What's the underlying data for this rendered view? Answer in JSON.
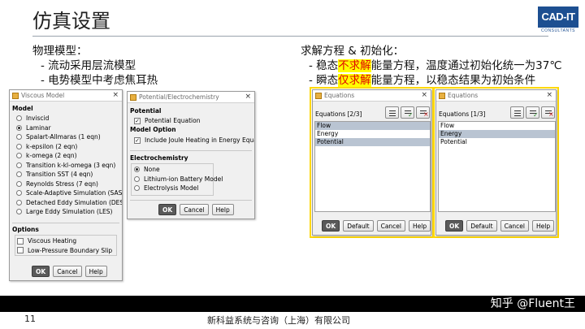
{
  "slide": {
    "title": "仿真设置",
    "page_number": "11",
    "company": "新科益系统与咨询（上海）有限公司",
    "footer_brand": "知乎 @Fluent王"
  },
  "logo": {
    "main": "CAD-IT",
    "sub": "CONSULTANTS"
  },
  "left_text": {
    "heading": "物理模型：",
    "bullets": [
      "- 流动采用层流模型",
      "- 电势模型中考虑焦耳热"
    ]
  },
  "right_text": {
    "heading": "求解方程 & 初始化：",
    "bullet1": {
      "prefix": "- 稳态",
      "highlight": "不求解",
      "suffix": "能量方程，温度通过初始化统一为37℃"
    },
    "bullet2": {
      "prefix": "- 瞬态",
      "highlight": "仅求解",
      "suffix": "能量方程，以稳态结果为初始条件"
    }
  },
  "viscous_dialog": {
    "title": "Viscous Model",
    "model_label": "Model",
    "models": [
      {
        "label": "Inviscid",
        "selected": false
      },
      {
        "label": "Laminar",
        "selected": true
      },
      {
        "label": "Spalart-Allmaras (1 eqn)",
        "selected": false
      },
      {
        "label": "k-epsilon (2 eqn)",
        "selected": false
      },
      {
        "label": "k-omega (2 eqn)",
        "selected": false
      },
      {
        "label": "Transition k-kl-omega (3 eqn)",
        "selected": false
      },
      {
        "label": "Transition SST (4 eqn)",
        "selected": false
      },
      {
        "label": "Reynolds Stress (7 eqn)",
        "selected": false
      },
      {
        "label": "Scale-Adaptive Simulation (SAS)",
        "selected": false
      },
      {
        "label": "Detached Eddy Simulation (DES)",
        "selected": false
      },
      {
        "label": "Large Eddy Simulation (LES)",
        "selected": false
      }
    ],
    "options_label": "Options",
    "options": [
      {
        "label": "Viscous Heating",
        "checked": false
      },
      {
        "label": "Low-Pressure Boundary Slip",
        "checked": false
      }
    ],
    "buttons": {
      "ok": "OK",
      "cancel": "Cancel",
      "help": "Help"
    }
  },
  "potential_dialog": {
    "title": "Potential/Electrochemistry",
    "potential_label": "Potential",
    "potential_equation": "Potential Equation",
    "model_option_label": "Model Option",
    "joule_heating": "Include Joule Heating in Energy Equation",
    "electrochem_label": "Electrochemistry",
    "electrochem_options": [
      {
        "label": "None",
        "selected": true
      },
      {
        "label": "Lithium-ion Battery Model",
        "selected": false
      },
      {
        "label": "Electrolysis Model",
        "selected": false
      }
    ],
    "buttons": {
      "ok": "OK",
      "cancel": "Cancel",
      "help": "Help"
    }
  },
  "equations_steady": {
    "title": "Equations",
    "count_label": "Equations  [2/3]",
    "items": [
      {
        "label": "Flow",
        "selected": true
      },
      {
        "label": "Energy",
        "selected": false
      },
      {
        "label": "Potential",
        "selected": true
      }
    ],
    "buttons": {
      "ok": "OK",
      "default": "Default",
      "cancel": "Cancel",
      "help": "Help"
    }
  },
  "equations_transient": {
    "title": "Equations",
    "count_label": "Equations  [1/3]",
    "items": [
      {
        "label": "Flow",
        "selected": false
      },
      {
        "label": "Energy",
        "selected": true
      },
      {
        "label": "Potential",
        "selected": false
      }
    ],
    "buttons": {
      "ok": "OK",
      "default": "Default",
      "cancel": "Cancel",
      "help": "Help"
    }
  },
  "colors": {
    "highlight_bg": "#ffff00",
    "highlight_text": "#e00000",
    "frame_yellow": "#ffd800",
    "logo_blue": "#1d4f91"
  }
}
